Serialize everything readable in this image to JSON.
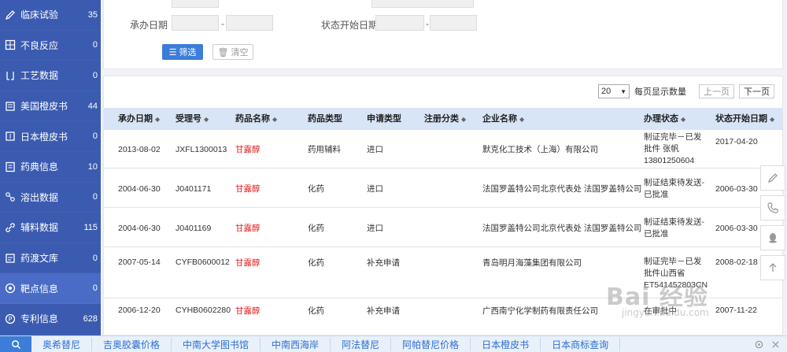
{
  "sidebar": {
    "items": [
      {
        "label": "临床试验",
        "count": "35",
        "icon": "pen-icon"
      },
      {
        "label": "不良反应",
        "count": "0",
        "icon": "grid-icon"
      },
      {
        "label": "工艺数据",
        "count": "0",
        "icon": "bracket-icon"
      },
      {
        "label": "美国橙皮书",
        "count": "44",
        "icon": "book-icon"
      },
      {
        "label": "日本橙皮书",
        "count": "0",
        "icon": "calendar-icon"
      },
      {
        "label": "药典信息",
        "count": "10",
        "icon": "doc-icon"
      },
      {
        "label": "溶出数据",
        "count": "0",
        "icon": "nodes-icon"
      },
      {
        "label": "辅料数据",
        "count": "115",
        "icon": "link-icon"
      },
      {
        "label": "药渡文库",
        "count": "0",
        "icon": "library-icon"
      },
      {
        "label": "靶点信息",
        "count": "0",
        "icon": "target-icon"
      },
      {
        "label": "专利信息",
        "count": "628",
        "icon": "p-circle-icon"
      }
    ]
  },
  "filters": {
    "undertake_date_label": "承办日期",
    "status_start_label": "状态开始日期",
    "dash": "-",
    "filter_button": "筛选",
    "clear_button": "清空"
  },
  "pager": {
    "page_size": "20",
    "per_page_label": "每页显示数量",
    "prev": "上一页",
    "next": "下一页"
  },
  "table": {
    "columns": [
      "承办日期",
      "受理号",
      "药品名称",
      "药品类型",
      "申请类型",
      "注册分类",
      "企业名称",
      "办理状态",
      "状态开始日期"
    ],
    "rows": [
      {
        "date": "2013-08-02",
        "no": "JXFL1300013",
        "drug": "甘露醇",
        "type": "药用辅料",
        "app": "进口",
        "cls": "",
        "company": "默克化工技术（上海）有限公司",
        "status": "制证完毕－已发批件 张帆 13801250604",
        "start": "2017-04-20"
      },
      {
        "date": "2004-06-30",
        "no": "J0401171",
        "drug": "甘露醇",
        "type": "化药",
        "app": "进口",
        "cls": "",
        "company": "法国罗盖特公司北京代表处 法国罗盖特公司",
        "status": "制证结束待发送-已批准",
        "start": "2006-03-30"
      },
      {
        "date": "2004-06-30",
        "no": "J0401169",
        "drug": "甘露醇",
        "type": "化药",
        "app": "进口",
        "cls": "",
        "company": "法国罗盖特公司北京代表处 法国罗盖特公司",
        "status": "制证结束待发送-已批准",
        "start": "2006-03-30"
      },
      {
        "date": "2007-05-14",
        "no": "CYFB0600012",
        "drug": "甘露醇",
        "type": "化药",
        "app": "补充申请",
        "cls": "",
        "company": "青岛明月海藻集团有限公司",
        "status": "制证完毕－已发批件山西省 ET541452803CN",
        "start": "2008-02-18"
      },
      {
        "date": "2006-12-20",
        "no": "CYHB0602280",
        "drug": "甘露醇",
        "type": "化药",
        "app": "补充申请",
        "cls": "",
        "company": "广西南宁化学制药有限责任公司",
        "status": "在审批中",
        "start": "2007-11-22"
      }
    ]
  },
  "bottom_bar": {
    "links": [
      "奥希替尼",
      "吉奥胶囊价格",
      "中南大学图书馆",
      "中南西海岸",
      "阿法替尼",
      "阿帕替尼价格",
      "日本橙皮书",
      "日本商标查询"
    ]
  },
  "watermark": {
    "text": "Bai 经验",
    "sub": "jingyan.baidu.com"
  },
  "colors": {
    "sidebar": "#3a5bb0",
    "accent": "#3b7dd8",
    "drug_name": "#e02020",
    "table_header": "#d7e5f7"
  }
}
